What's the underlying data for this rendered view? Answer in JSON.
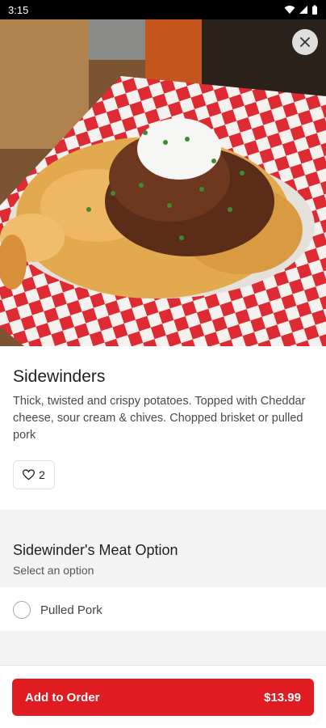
{
  "status_bar": {
    "time": "3:15"
  },
  "item": {
    "title": "Sidewinders",
    "description": "Thick, twisted and crispy potatoes. Topped with Cheddar cheese, sour cream & chives. Chopped brisket or pulled pork",
    "likes": "2"
  },
  "option_group": {
    "title": "Sidewinder's Meat Option",
    "subtitle": "Select an option",
    "options": [
      {
        "label": "Pulled Pork"
      }
    ]
  },
  "cart_button": {
    "label": "Add to Order",
    "price": "$13.99"
  },
  "colors": {
    "accent": "#e11b22",
    "section_bg": "#f3f3f3"
  },
  "icons": {
    "close": "close-icon",
    "like": "heart-icon"
  }
}
